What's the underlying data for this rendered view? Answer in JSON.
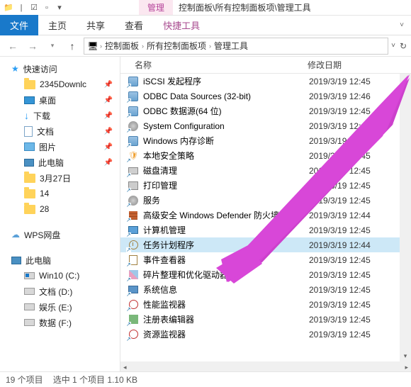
{
  "titlebar": {
    "tool_tab": "管理",
    "path": "控制面板\\所有控制面板项\\管理工具"
  },
  "ribbon": {
    "file": "文件",
    "home": "主页",
    "share": "共享",
    "view": "查看",
    "tools": "快捷工具"
  },
  "breadcrumb": {
    "items": [
      "控制面板",
      "所有控制面板项",
      "管理工具"
    ]
  },
  "nav": {
    "quick_access": "快速访问",
    "items": [
      {
        "label": "2345Downlc",
        "kind": "folder",
        "pin": true
      },
      {
        "label": "桌面",
        "kind": "desktop",
        "pin": true
      },
      {
        "label": "下载",
        "kind": "dl",
        "pin": true
      },
      {
        "label": "文档",
        "kind": "doc",
        "pin": true
      },
      {
        "label": "图片",
        "kind": "pic",
        "pin": true
      },
      {
        "label": "此电脑",
        "kind": "pc",
        "pin": true
      },
      {
        "label": "3月27日",
        "kind": "folder",
        "pin": false
      },
      {
        "label": "14",
        "kind": "folder",
        "pin": false
      },
      {
        "label": "28",
        "kind": "folder",
        "pin": false
      }
    ],
    "wps": "WPS网盘",
    "this_pc": "此电脑",
    "drives": [
      {
        "label": "Win10 (C:)",
        "win": true
      },
      {
        "label": "文档 (D:)",
        "win": false
      },
      {
        "label": "娱乐 (E:)",
        "win": false
      },
      {
        "label": "数据 (F:)",
        "win": false
      }
    ]
  },
  "columns": {
    "name": "名称",
    "date": "修改日期"
  },
  "rows": [
    {
      "name": "iSCSI 发起程序",
      "date": "2019/3/19 12:45",
      "icon": "box"
    },
    {
      "name": "ODBC Data Sources (32-bit)",
      "date": "2019/3/19 12:46",
      "icon": "box"
    },
    {
      "name": "ODBC 数据源(64 位)",
      "date": "2019/3/19 12:45",
      "icon": "box"
    },
    {
      "name": "System Configuration",
      "date": "2019/3/19 12:45",
      "icon": "gear"
    },
    {
      "name": "Windows 内存诊断",
      "date": "2019/3/19 12:45",
      "icon": "box"
    },
    {
      "name": "本地安全策略",
      "date": "2019/3/19 12:45",
      "icon": "shield"
    },
    {
      "name": "磁盘清理",
      "date": "2019/3/19 12:45",
      "icon": "disk"
    },
    {
      "name": "打印管理",
      "date": "2019/3/19 12:45",
      "icon": "print"
    },
    {
      "name": "服务",
      "date": "2019/3/19 12:45",
      "icon": "gear"
    },
    {
      "name": "高级安全 Windows Defender 防火墙",
      "date": "2019/3/19 12:44",
      "icon": "wall"
    },
    {
      "name": "计算机管理",
      "date": "2019/3/19 12:45",
      "icon": "mon"
    },
    {
      "name": "任务计划程序",
      "date": "2019/3/19 12:44",
      "icon": "clock",
      "selected": true
    },
    {
      "name": "事件查看器",
      "date": "2019/3/19 12:45",
      "icon": "event"
    },
    {
      "name": "碎片整理和优化驱动器",
      "date": "2019/3/19 12:45",
      "icon": "opt"
    },
    {
      "name": "系统信息",
      "date": "2019/3/19 12:45",
      "icon": "info"
    },
    {
      "name": "性能监视器",
      "date": "2019/3/19 12:45",
      "icon": "perf"
    },
    {
      "name": "注册表编辑器",
      "date": "2019/3/19 12:45",
      "icon": "reg"
    },
    {
      "name": "资源监视器",
      "date": "2019/3/19 12:45",
      "icon": "perf"
    }
  ],
  "status": {
    "count": "19 个项目",
    "selected": "选中 1 个项目  1.10 KB"
  }
}
